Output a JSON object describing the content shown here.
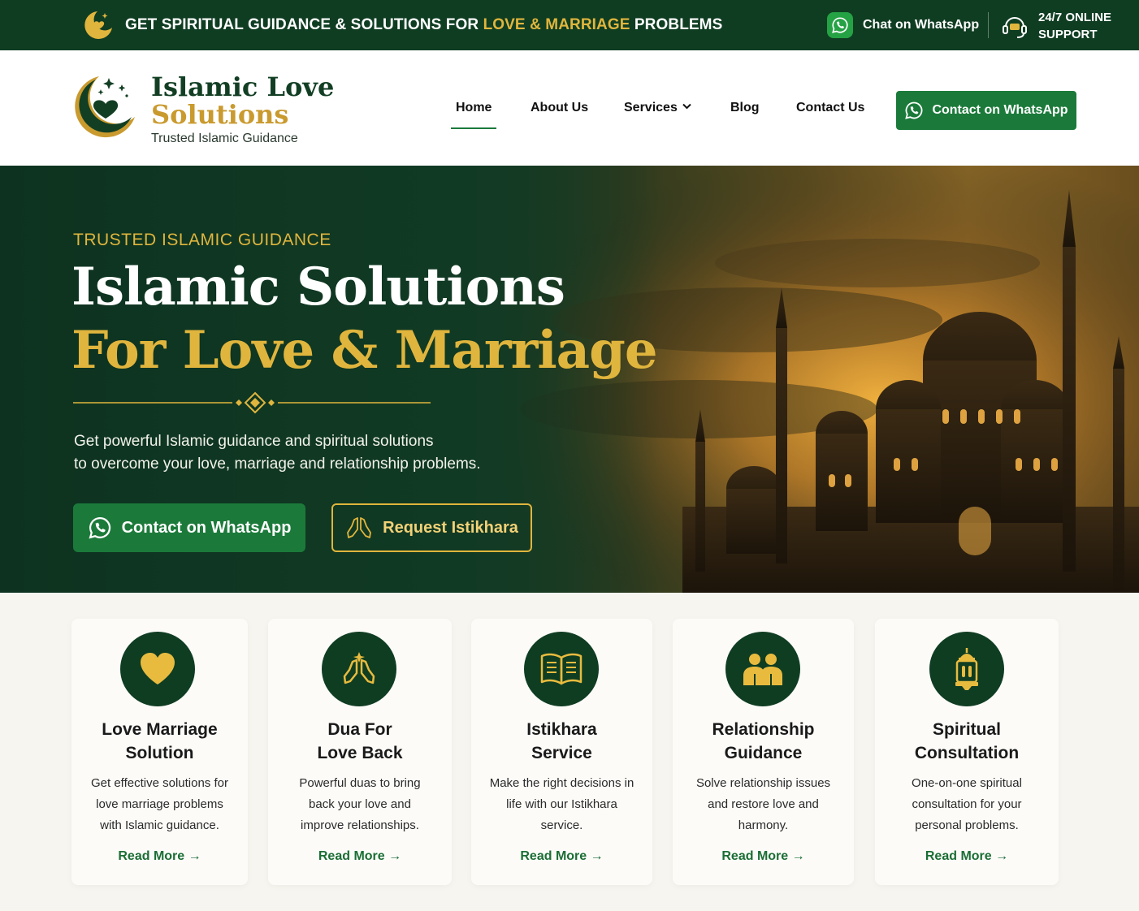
{
  "topbar": {
    "promo_pre": "GET SPIRITUAL GUIDANCE & SOLUTIONS FOR ",
    "promo_highlight": "LOVE & MARRIAGE",
    "promo_post": " PROBLEMS",
    "chat_label": "Chat on WhatsApp",
    "support_line1": "24/7 ONLINE",
    "support_line2": "SUPPORT"
  },
  "logo": {
    "title_line1": "Islamic Love",
    "title_line2": "Solutions",
    "tagline": "Trusted Islamic Guidance"
  },
  "nav": {
    "items": [
      "Home",
      "About Us",
      "Services",
      "Blog",
      "Contact Us"
    ],
    "active": "Home",
    "cta": "Contact on WhatsApp"
  },
  "hero": {
    "eyebrow": "TRUSTED ISLAMIC GUIDANCE",
    "title_line1": "Islamic Solutions",
    "title_line2": "For Love & Marriage",
    "desc_line1": "Get powerful Islamic guidance and spiritual solutions",
    "desc_line2": "to overcome your love, marriage and relationship problems.",
    "primary_button": "Contact on WhatsApp",
    "secondary_button": "Request Istikhara"
  },
  "services": [
    {
      "title1": "Love Marriage",
      "title2": "Solution",
      "desc1": "Get effective solutions for",
      "desc2": "love marriage problems",
      "desc3": "with Islamic guidance.",
      "link": "Read More →",
      "icon": "heart-icon"
    },
    {
      "title1": "Dua For",
      "title2": "Love Back",
      "desc1": "Powerful duas to bring",
      "desc2": "back your love and",
      "desc3": "improve relationships.",
      "link": "Read More →",
      "icon": "praying-hands-icon"
    },
    {
      "title1": "Istikhara",
      "title2": "Service",
      "desc1": "Make the right decisions in",
      "desc2": "life with our Istikhara",
      "desc3": "service.",
      "link": "Read More →",
      "icon": "open-book-icon"
    },
    {
      "title1": "Relationship",
      "title2": "Guidance",
      "desc1": "Solve relationship issues",
      "desc2": "and restore love and",
      "desc3": "harmony.",
      "link": "Read More →",
      "icon": "couple-icon"
    },
    {
      "title1": "Spiritual",
      "title2": "Consultation",
      "desc1": "One-on-one spiritual",
      "desc2": "consultation for your",
      "desc3": "personal problems.",
      "link": "Read More →",
      "icon": "lantern-icon"
    }
  ],
  "colors": {
    "dark_green": "#0f3d22",
    "brand_green": "#1b7a3a",
    "gold": "#e0b53d",
    "cream": "#f7f5ef"
  }
}
